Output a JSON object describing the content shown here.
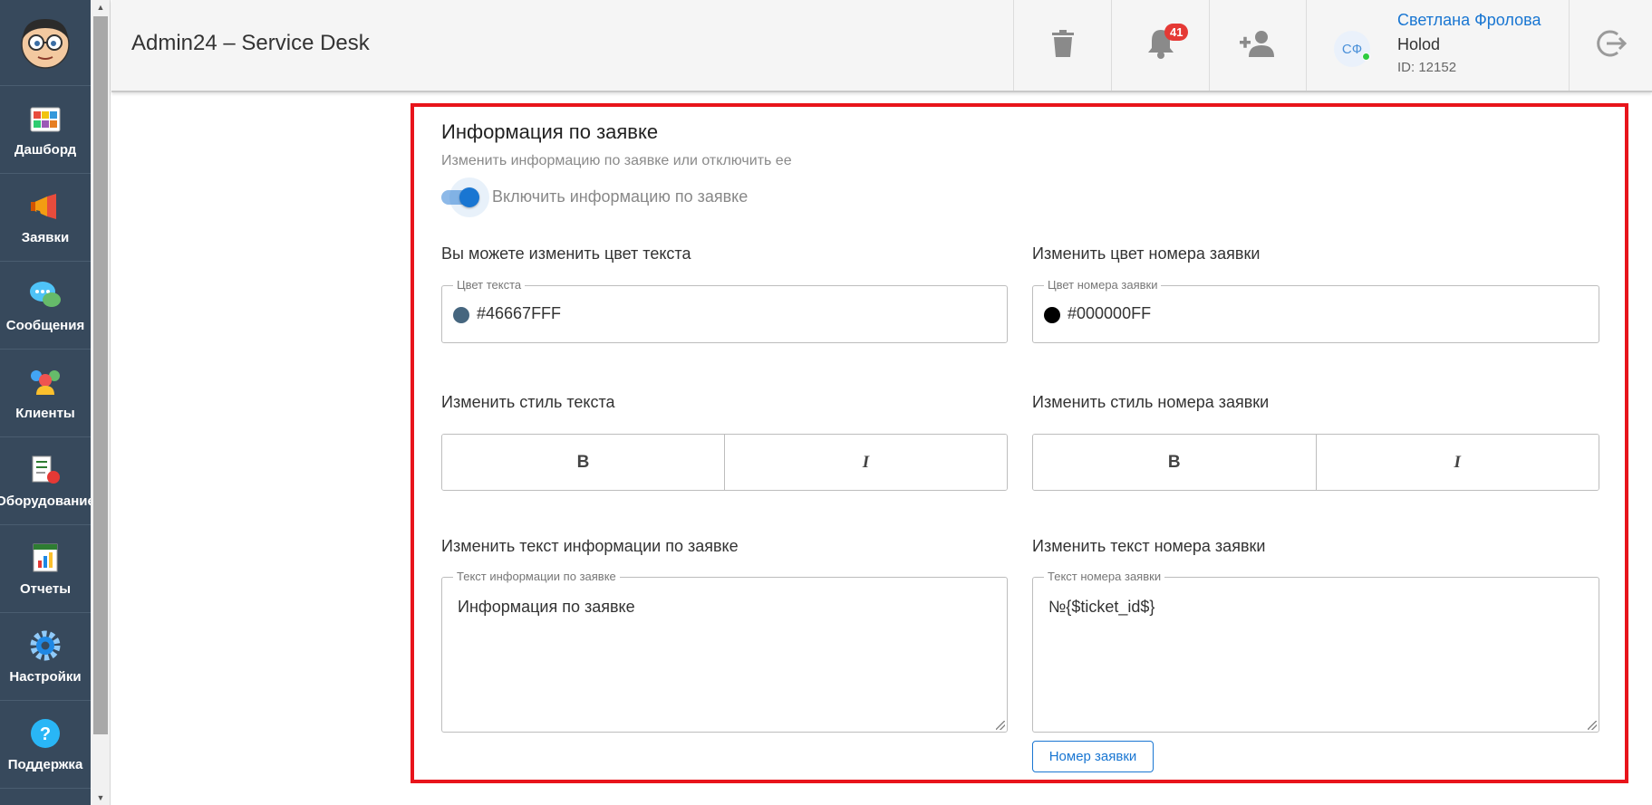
{
  "app": {
    "title": "Admin24 – Service Desk"
  },
  "sidebar": {
    "items": [
      {
        "label": "Дашборд",
        "icon": "dashboard-icon"
      },
      {
        "label": "Заявки",
        "icon": "megaphone-icon"
      },
      {
        "label": "Сообщения",
        "icon": "chat-icon"
      },
      {
        "label": "Клиенты",
        "icon": "clients-icon"
      },
      {
        "label": "Оборудование",
        "icon": "equipment-icon"
      },
      {
        "label": "Отчеты",
        "icon": "reports-icon"
      },
      {
        "label": "Настройки",
        "icon": "gear-icon"
      },
      {
        "label": "Поддержка",
        "icon": "help-icon"
      }
    ]
  },
  "header": {
    "notifications_count": "41",
    "user": {
      "initials": "СФ",
      "name": "Светлана Фролова",
      "org": "Holod",
      "id": "ID: 12152"
    }
  },
  "section": {
    "title": "Информация по заявке",
    "subtitle": "Изменить информацию по заявке или отключить ее",
    "toggle_label": "Включить информацию по заявке",
    "toggle_on": true
  },
  "left": {
    "color_label": "Вы можете изменить цвет текста",
    "color_legend": "Цвет текста",
    "color_value": "#46667FFF",
    "color_hex": "#46667F",
    "style_label": "Изменить стиль текста",
    "bold_label": "B",
    "italic_label": "I",
    "text_label": "Изменить текст информации по заявке",
    "text_legend": "Текст информации по заявке",
    "text_value": "Информация по заявке"
  },
  "right": {
    "color_label": "Изменить цвет номера заявки",
    "color_legend": "Цвет номера заявки",
    "color_value": "#000000FF",
    "color_hex": "#000000",
    "style_label": "Изменить стиль номера заявки",
    "bold_label": "B",
    "italic_label": "I",
    "text_label": "Изменить текст номера заявки",
    "text_legend": "Текст номера заявки",
    "text_value": "№{$ticket_id$}",
    "insert_button": "Номер заявки"
  },
  "colors": {
    "accent": "#1976d2",
    "highlight_border": "#e8141b",
    "sidebar": "#37495c"
  }
}
